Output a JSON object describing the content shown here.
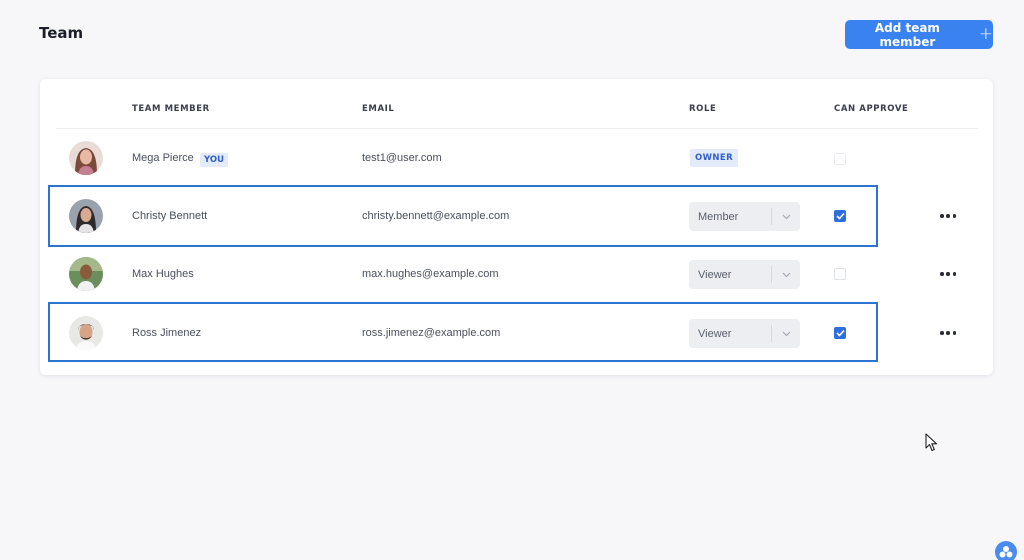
{
  "page": {
    "title": "Team"
  },
  "toolbar": {
    "add_label": "Add team member",
    "add_icon": "plus-icon"
  },
  "table": {
    "headers": {
      "member": "TEAM MEMBER",
      "email": "EMAIL",
      "role": "ROLE",
      "approve": "CAN APPROVE"
    },
    "rows": [
      {
        "name": "Mega Pierce",
        "badge": "YOU",
        "email": "test1@user.com",
        "role": "OWNER",
        "role_type": "badge",
        "can_approve": false,
        "highlighted": false
      },
      {
        "name": "Christy Bennett",
        "email": "christy.bennett@example.com",
        "role": "Member",
        "role_type": "select",
        "can_approve": true,
        "highlighted": true
      },
      {
        "name": "Max Hughes",
        "email": "max.hughes@example.com",
        "role": "Viewer",
        "role_type": "select",
        "can_approve": false,
        "highlighted": false
      },
      {
        "name": "Ross Jimenez",
        "email": "ross.jimenez@example.com",
        "role": "Viewer",
        "role_type": "select",
        "can_approve": true,
        "highlighted": true
      }
    ]
  },
  "colors": {
    "accent": "#3b82f1",
    "highlight": "#2c74d0",
    "badge_bg": "#e3ebfb",
    "badge_text": "#2f5fc7"
  }
}
